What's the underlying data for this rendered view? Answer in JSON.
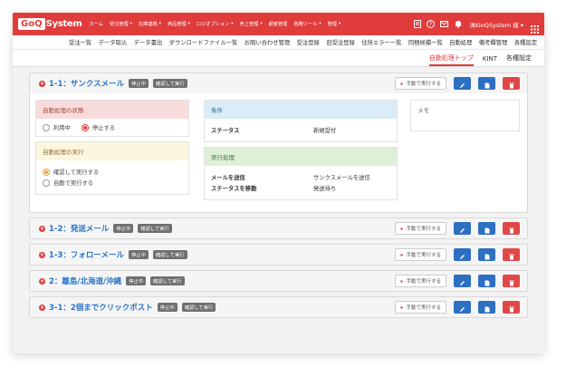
{
  "topbar": {
    "logo_badge": "GoQ",
    "logo_text": "System",
    "nav": [
      {
        "label": "ホーム",
        "caret": false
      },
      {
        "label": "受注管理",
        "caret": true
      },
      {
        "label": "在庫連携",
        "caret": true
      },
      {
        "label": "商品管理",
        "caret": true
      },
      {
        "label": "ロジオプション",
        "caret": true
      },
      {
        "label": "売上管理",
        "caret": true
      },
      {
        "label": "顧客管理",
        "caret": false
      },
      {
        "label": "各種ツール",
        "caret": true
      },
      {
        "label": "管理",
        "caret": true
      }
    ],
    "user": "㈱GoQSystem 様"
  },
  "subnav": [
    "受注一覧",
    "データ取込",
    "データ書出",
    "ダウンロードファイル一覧",
    "お問い合わせ管理",
    "受注登録",
    "旧受注登録",
    "住所エラー一覧",
    "同梱候補一覧",
    "自動処理",
    "備考欄管理",
    "各種設定"
  ],
  "tabs": [
    "自動処理トップ",
    "KINT",
    "各種設定"
  ],
  "active_tab": "自動処理トップ",
  "cards": [
    {
      "title": "1-1：サンクスメール",
      "badges": [
        "停止中",
        "確認して実行"
      ],
      "manual": "手動で実行する",
      "expanded": true
    },
    {
      "title": "1-2：発送メール",
      "badges": [
        "停止中",
        "確認して実行"
      ],
      "manual": "手動で実行する"
    },
    {
      "title": "1-3：フォローメール",
      "badges": [
        "停止中",
        "確認して実行"
      ],
      "manual": "手動で実行する"
    },
    {
      "title": "2：離島/北海道/沖縄",
      "badges": [
        "停止中",
        "確認して実行"
      ],
      "manual": "手動で実行する"
    },
    {
      "title": "3-1：2個までクリックポスト",
      "badges": [
        "停止中",
        "確認して実行"
      ],
      "manual": "手動で実行する"
    }
  ],
  "detail": {
    "status_header": "自動処理の状態",
    "status_options": [
      "利用中",
      "停止する"
    ],
    "status_selected": "停止する",
    "exec_header": "自動処理の実行",
    "exec_options": [
      "確認して実行する",
      "自動で実行する"
    ],
    "exec_selected": "確認して実行する",
    "cond_header": "条件",
    "cond_rows": [
      {
        "k": "ステータス",
        "v": "新規受付"
      }
    ],
    "proc_header": "実行処理",
    "proc_rows": [
      {
        "k": "メールを送信",
        "v": "サンクスメールを送信"
      },
      {
        "k": "ステータスを移動",
        "v": "発送待ち"
      }
    ],
    "memo_header": "メモ"
  },
  "colors": {
    "brand_red": "#e03c3c",
    "link_blue": "#2a75c8",
    "button_blue": "#2d6fc2"
  }
}
